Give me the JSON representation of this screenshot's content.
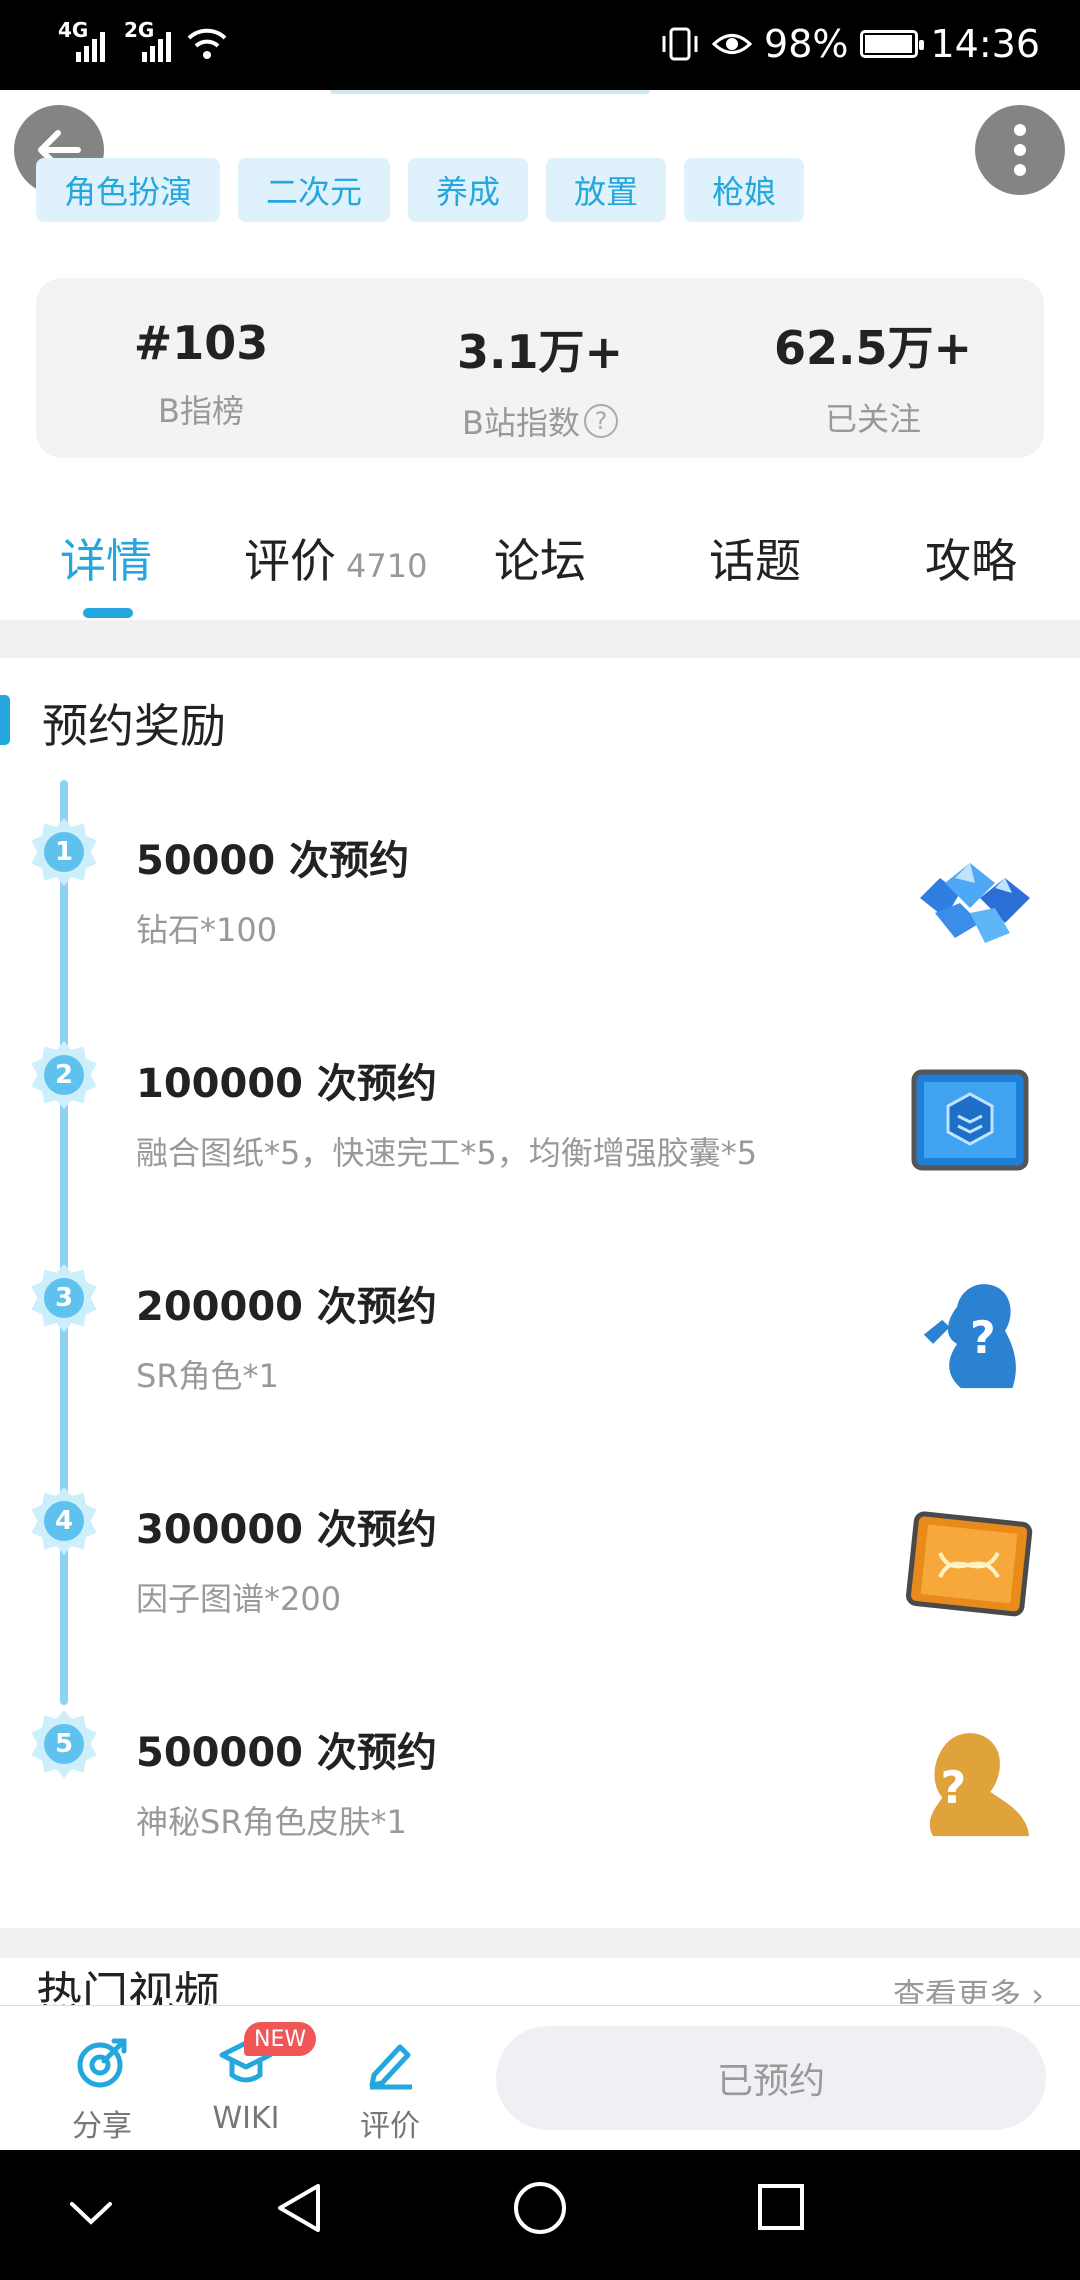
{
  "status_bar": {
    "network_1": "4G",
    "network_2": "2G",
    "battery": "98%",
    "time": "14:36"
  },
  "tags": [
    "角色扮演",
    "二次元",
    "养成",
    "放置",
    "枪娘"
  ],
  "stats": [
    {
      "value": "#103",
      "label": "B指榜"
    },
    {
      "value": "3.1万+",
      "label": "B站指数"
    },
    {
      "value": "62.5万+",
      "label": "已关注"
    }
  ],
  "tabs": [
    {
      "label": "详情",
      "active": true
    },
    {
      "label": "评价",
      "count": "4710"
    },
    {
      "label": "论坛"
    },
    {
      "label": "话题"
    },
    {
      "label": "攻略"
    }
  ],
  "rewards_section": {
    "title": "预约奖励",
    "items": [
      {
        "step": "1",
        "title": "50000 次预约",
        "desc": "钻石*100",
        "icon": "diamonds-icon"
      },
      {
        "step": "2",
        "title": "100000 次预约",
        "desc": "融合图纸*5，快速完工*5，均衡增强胶囊*5",
        "icon": "blueprint-icon"
      },
      {
        "step": "3",
        "title": "200000 次预约",
        "desc": "SR角色*1",
        "icon": "mystery-character-icon"
      },
      {
        "step": "4",
        "title": "300000 次预约",
        "desc": "因子图谱*200",
        "icon": "dna-chart-icon"
      },
      {
        "step": "5",
        "title": "500000 次预约",
        "desc": "神秘SR角色皮肤*1",
        "icon": "mystery-skin-icon"
      }
    ]
  },
  "hot_videos": {
    "title": "热门视频",
    "more": "查看更多"
  },
  "action_bar": {
    "share": "分享",
    "wiki": "WIKI",
    "new_badge": "NEW",
    "review": "评价",
    "reserve_button": "已预约"
  },
  "colors": {
    "accent": "#23a7dd",
    "tag_bg": "#dff1fa",
    "timeline": "#8fd1f0",
    "new_badge": "#f05656"
  }
}
